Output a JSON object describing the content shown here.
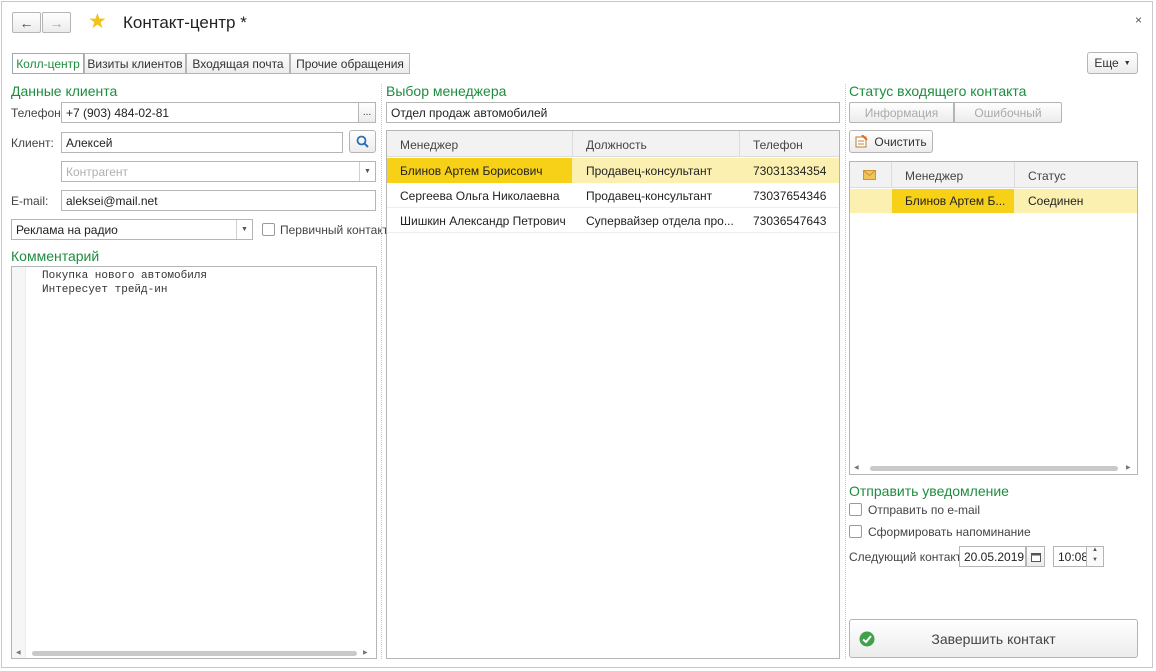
{
  "window": {
    "title": "Контакт-центр *",
    "close": "×"
  },
  "tabs": [
    "Колл-центр",
    "Визиты клиентов",
    "Входящая почта",
    "Прочие обращения"
  ],
  "more_button": "Еще",
  "client": {
    "section_title": "Данные клиента",
    "phone_label": "Телефон:",
    "phone_value": "+7 (903) 484-02-81",
    "phone_more": "...",
    "client_label": "Клиент:",
    "client_value": "Алексей",
    "counterparty_placeholder": "Контрагент",
    "email_label": "E-mail:",
    "email_value": "aleksei@mail.net",
    "source_value": "Реклама на радио",
    "primary_contact_label": "Первичный контакт",
    "comment_title": "Комментарий",
    "comment_lines": [
      "Покупка нового автомобиля",
      "Интересует трейд-ин"
    ]
  },
  "manager_select": {
    "section_title": "Выбор менеджера",
    "department": "Отдел продаж автомобилей",
    "columns": [
      "Менеджер",
      "Должность",
      "Телефон"
    ],
    "rows": [
      [
        "Блинов Артем Борисович",
        "Продавец-консультант",
        "73031334354"
      ],
      [
        "Сергеева Ольга Николаевна",
        "Продавец-консультант",
        "73037654346"
      ],
      [
        "Шишкин Александр Петрович",
        "Супервайзер отдела про...",
        "73036547643"
      ]
    ]
  },
  "status": {
    "section_title": "Статус входящего контакта",
    "info_button": "Информация",
    "error_button": "Ошибочный",
    "clear_button": "Очистить",
    "columns": [
      "Менеджер",
      "Статус"
    ],
    "rows": [
      [
        "Блинов Артем Б...",
        "Соединен"
      ]
    ]
  },
  "notify": {
    "section_title": "Отправить уведомление",
    "email_label": "Отправить по e-mail",
    "reminder_label": "Сформировать напоминание",
    "next_contact_label": "Следующий контакт:",
    "next_date": "20.05.2019",
    "next_time": "10:08"
  },
  "finish_button": "Завершить контакт",
  "colors": {
    "accent_green": "#1d8d3e",
    "selected_row": "#f7d117",
    "selected_row_light": "#fbf0b0"
  }
}
